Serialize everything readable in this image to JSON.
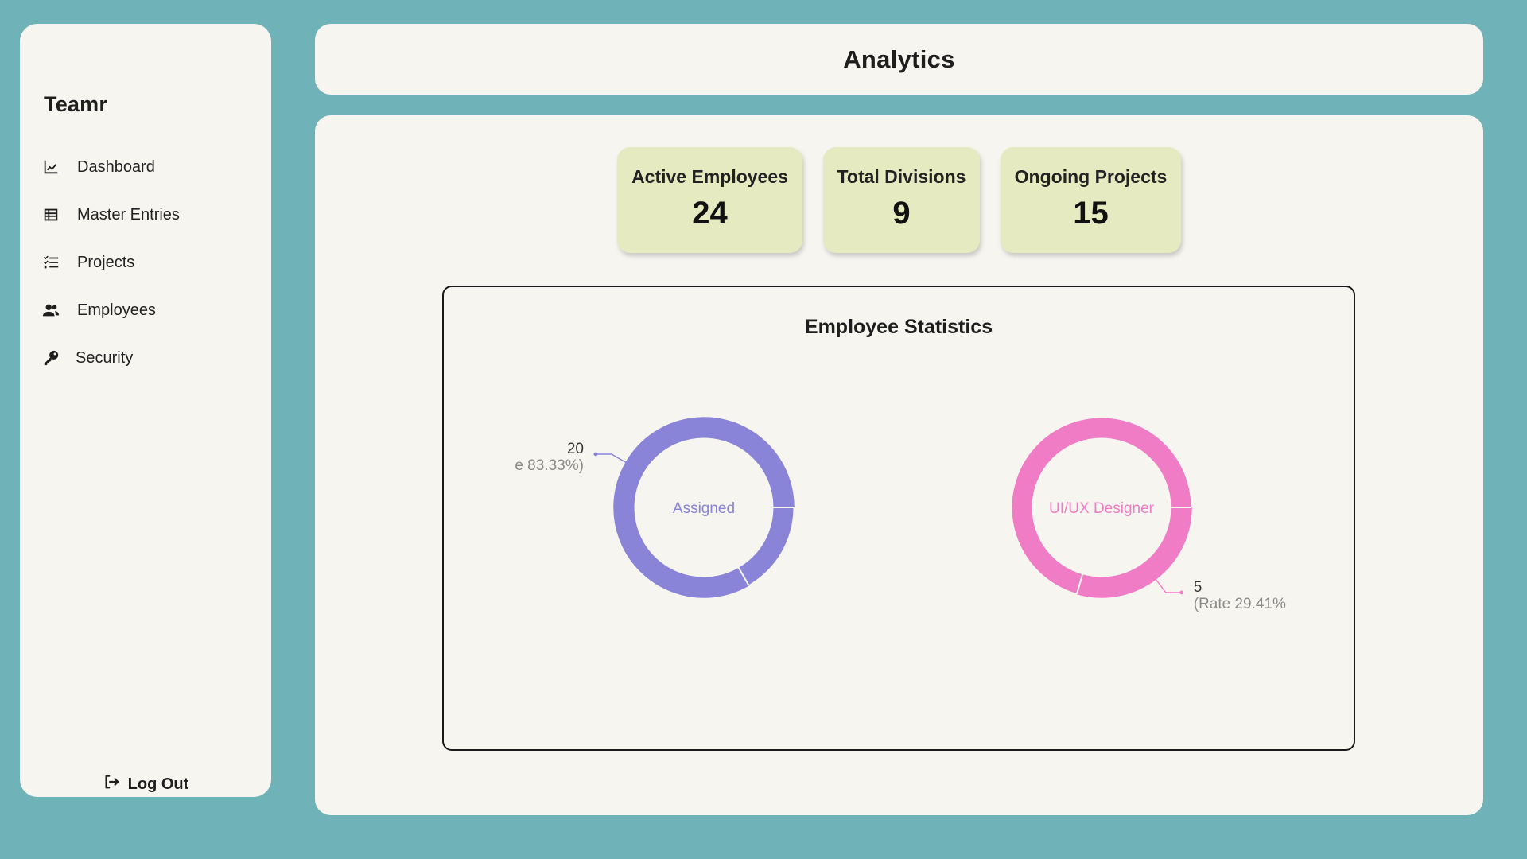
{
  "sidebar": {
    "brand": "Teamr",
    "items": [
      {
        "label": "Dashboard",
        "icon": "chart-line-icon"
      },
      {
        "label": "Master Entries",
        "icon": "table-icon"
      },
      {
        "label": "Projects",
        "icon": "list-check-icon"
      },
      {
        "label": "Employees",
        "icon": "users-icon"
      },
      {
        "label": "Security",
        "icon": "key-icon"
      }
    ],
    "logout_label": "Log Out",
    "logout_icon": "logout-icon"
  },
  "header": {
    "title": "Analytics"
  },
  "stats": [
    {
      "label": "Active Employees",
      "value": "24"
    },
    {
      "label": "Total Divisions",
      "value": "9"
    },
    {
      "label": "Ongoing Projects",
      "value": "15"
    }
  ],
  "chart_data": {
    "title": "Employee Statistics",
    "charts": [
      {
        "type": "pie",
        "center_label": "Assigned",
        "color": "#8a84d8",
        "active_value": 20,
        "active_rate_text": "e 83.33%)",
        "active_fraction": 0.8333
      },
      {
        "type": "pie",
        "center_label": "UI/UX Designer",
        "color": "#f07cc6",
        "active_value": 5,
        "active_rate_text": "(Rate 29.41%",
        "active_fraction": 0.2941
      }
    ]
  },
  "colors": {
    "background": "#6fb2b8",
    "panel": "#f6f5f0",
    "stat_card": "#e6eac0"
  }
}
